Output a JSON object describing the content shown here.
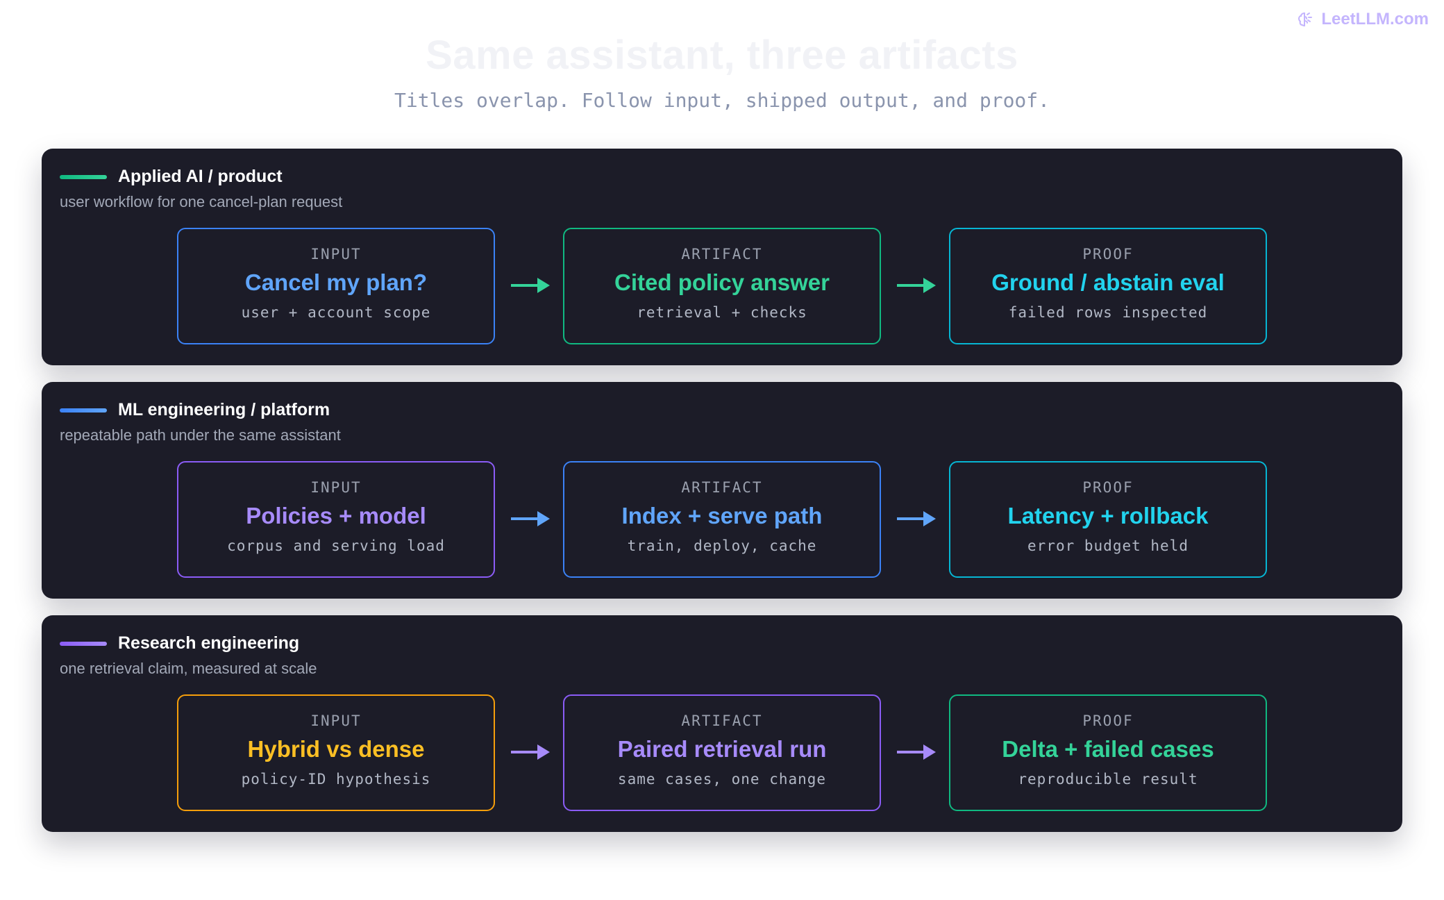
{
  "brand": {
    "label": "LeetLLM.com",
    "icon": "brain-icon"
  },
  "title": "Same assistant, three artifacts",
  "subtitle": "Titles overlap. Follow input, shipped output, and proof.",
  "kinds": {
    "input": "INPUT",
    "artifact": "ARTIFACT",
    "proof": "PROOF"
  },
  "lanes": [
    {
      "title": "Applied AI / product",
      "subtitle": "user workflow for one cancel-plan request",
      "accent": "#10b981",
      "arrow_color": "#34d399",
      "cards": [
        {
          "main": "Cancel my plan?",
          "detail": "user + account scope",
          "border": "#3b82f6",
          "color": "#60a5fa"
        },
        {
          "main": "Cited policy answer",
          "detail": "retrieval + checks",
          "border": "#10b981",
          "color": "#34d399"
        },
        {
          "main": "Ground / abstain eval",
          "detail": "failed rows inspected",
          "border": "#06b6d4",
          "color": "#22d3ee"
        }
      ]
    },
    {
      "title": "ML engineering / platform",
      "subtitle": "repeatable path under the same assistant",
      "accent": "#3b82f6",
      "arrow_color": "#60a5fa",
      "cards": [
        {
          "main": "Policies + model",
          "detail": "corpus and serving load",
          "border": "#8b5cf6",
          "color": "#a78bfa"
        },
        {
          "main": "Index + serve path",
          "detail": "train, deploy, cache",
          "border": "#3b82f6",
          "color": "#60a5fa"
        },
        {
          "main": "Latency + rollback",
          "detail": "error budget held",
          "border": "#06b6d4",
          "color": "#22d3ee"
        }
      ]
    },
    {
      "title": "Research engineering",
      "subtitle": "one retrieval claim, measured at scale",
      "accent": "#8b5cf6",
      "arrow_color": "#a78bfa",
      "cards": [
        {
          "main": "Hybrid vs dense",
          "detail": "policy-ID hypothesis",
          "border": "#f59e0b",
          "color": "#fbbf24"
        },
        {
          "main": "Paired retrieval run",
          "detail": "same cases, one change",
          "border": "#8b5cf6",
          "color": "#a78bfa"
        },
        {
          "main": "Delta + failed cases",
          "detail": "reproducible result",
          "border": "#10b981",
          "color": "#34d399"
        }
      ]
    }
  ]
}
